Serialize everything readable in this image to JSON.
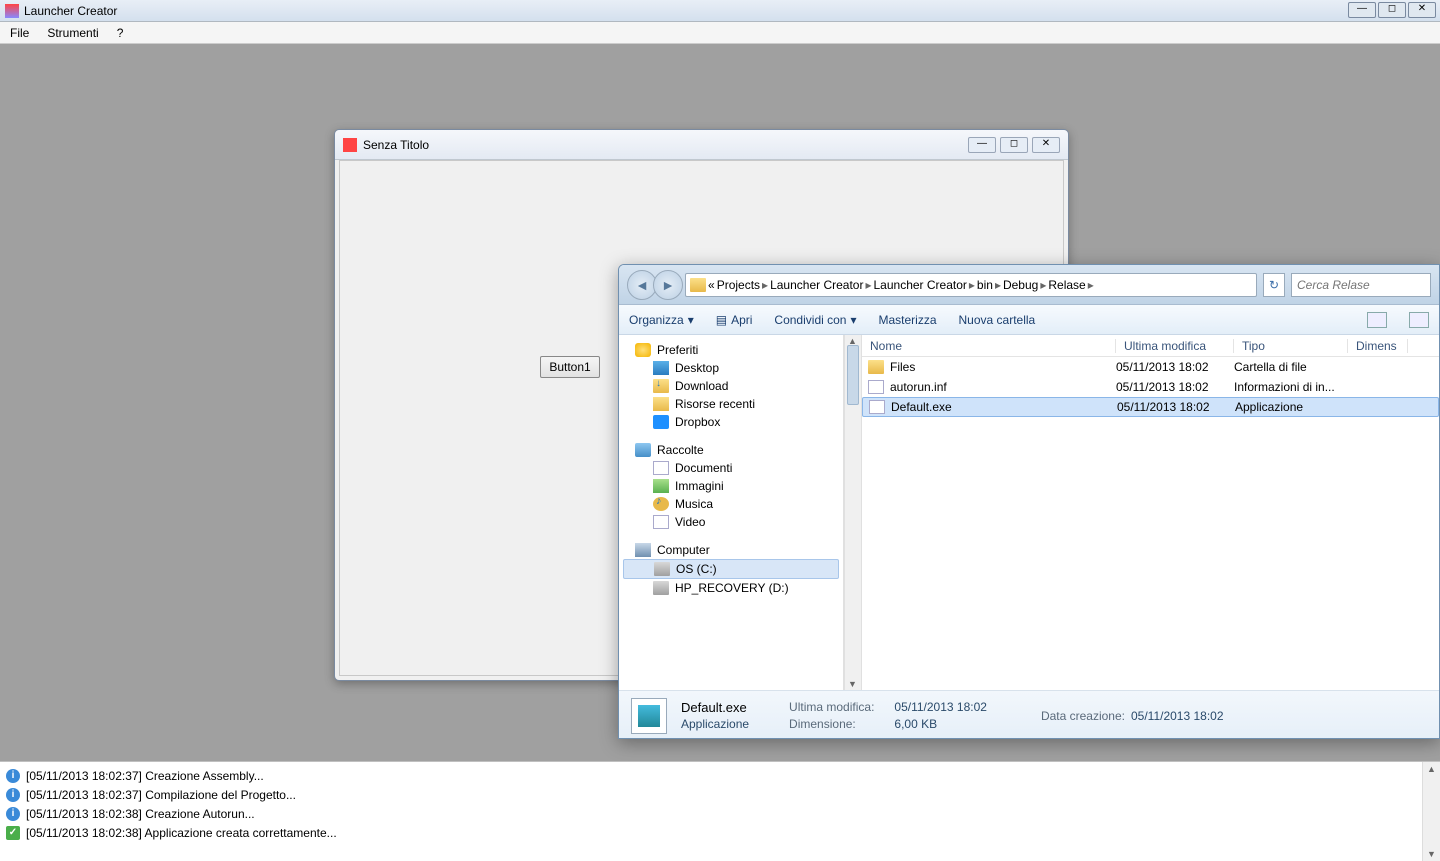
{
  "app": {
    "title": "Launcher Creator",
    "menu": {
      "file": "File",
      "tools": "Strumenti",
      "help": "?"
    }
  },
  "form": {
    "title": "Senza Titolo",
    "button1": "Button1"
  },
  "explorer": {
    "breadcrumb": [
      "Projects",
      "Launcher Creator",
      "Launcher Creator",
      "bin",
      "Debug",
      "Relase"
    ],
    "breadcrumb_prefix": "«",
    "search_placeholder": "Cerca Relase",
    "toolbar": {
      "organize": "Organizza",
      "open": "Apri",
      "share": "Condividi con",
      "burn": "Masterizza",
      "newfolder": "Nuova cartella"
    },
    "nav": {
      "favorites": {
        "label": "Preferiti",
        "items": [
          "Desktop",
          "Download",
          "Risorse recenti",
          "Dropbox"
        ]
      },
      "libraries": {
        "label": "Raccolte",
        "items": [
          "Documenti",
          "Immagini",
          "Musica",
          "Video"
        ]
      },
      "computer": {
        "label": "Computer",
        "items": [
          "OS (C:)",
          "HP_RECOVERY (D:)"
        ]
      }
    },
    "columns": {
      "name": "Nome",
      "modified": "Ultima modifica",
      "type": "Tipo",
      "size": "Dimens"
    },
    "files": [
      {
        "name": "Files",
        "modified": "05/11/2013 18:02",
        "type": "Cartella di file",
        "icon": "folder"
      },
      {
        "name": "autorun.inf",
        "modified": "05/11/2013 18:02",
        "type": "Informazioni di in...",
        "icon": "file"
      },
      {
        "name": "Default.exe",
        "modified": "05/11/2013 18:02",
        "type": "Applicazione",
        "icon": "exe",
        "selected": true
      }
    ],
    "details": {
      "filename": "Default.exe",
      "filetype": "Applicazione",
      "mod_label": "Ultima modifica:",
      "mod_value": "05/11/2013 18:02",
      "size_label": "Dimensione:",
      "size_value": "6,00 KB",
      "created_label": "Data creazione:",
      "created_value": "05/11/2013 18:02"
    }
  },
  "log": [
    {
      "type": "info",
      "text": "[05/11/2013 18:02:37] Creazione Assembly..."
    },
    {
      "type": "info",
      "text": "[05/11/2013 18:02:37] Compilazione del Progetto..."
    },
    {
      "type": "info",
      "text": "[05/11/2013 18:02:38] Creazione Autorun..."
    },
    {
      "type": "ok",
      "text": "[05/11/2013 18:02:38] Applicazione creata correttamente..."
    }
  ]
}
